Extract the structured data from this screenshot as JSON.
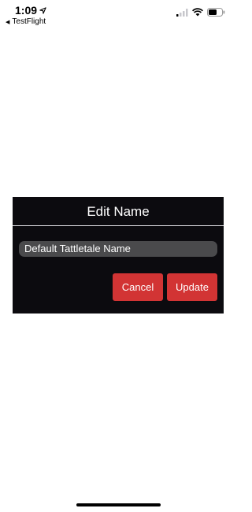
{
  "status_bar": {
    "time": "1:09",
    "back_app": "TestFlight",
    "location_icon": "location-arrow-icon",
    "signal_icon": "cellular-signal-icon",
    "wifi_icon": "wifi-icon",
    "battery_icon": "battery-icon"
  },
  "dialog": {
    "title": "Edit Name",
    "input_value": "Default Tattletale Name",
    "cancel_label": "Cancel",
    "update_label": "Update",
    "button_color": "#d23434",
    "background_color": "#0c0b0f"
  }
}
